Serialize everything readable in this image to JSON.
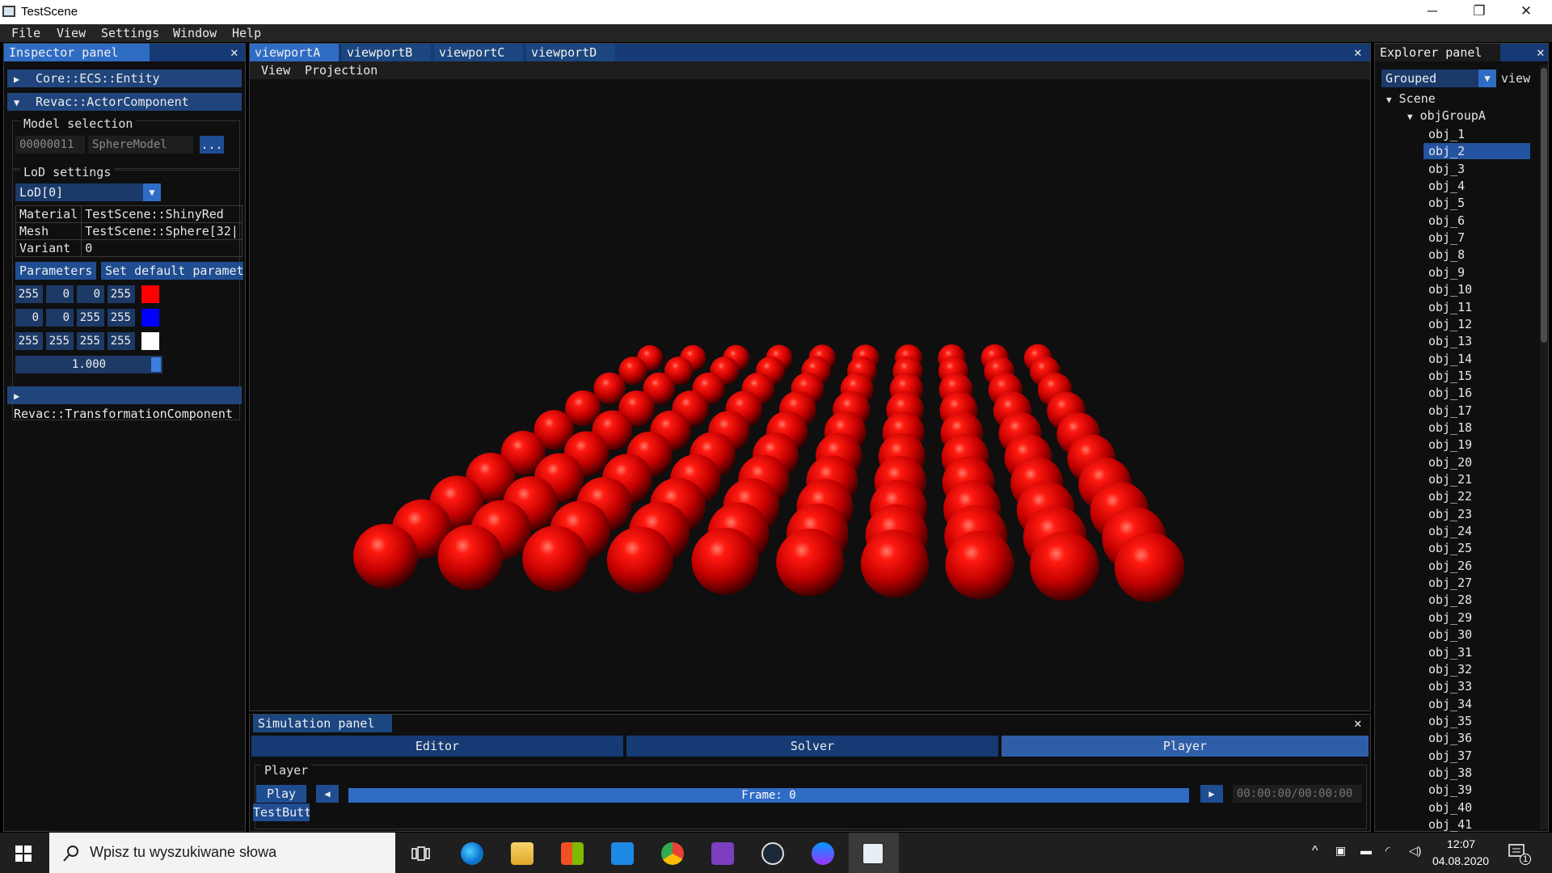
{
  "window": {
    "title": "TestScene",
    "minimize": "─",
    "restore": "❐",
    "close": "✕"
  },
  "menubar": [
    "File",
    "View",
    "Settings",
    "Window",
    "Help"
  ],
  "inspector": {
    "tab": "Inspector panel",
    "close": "✕",
    "entity_header": "Core::ECS::Entity",
    "actor_header": "Revac::ActorComponent",
    "model_selection_label": "Model selection",
    "model_id": "00000011",
    "model_name": "SphereModel",
    "browse_button": "...",
    "lod_settings_label": "LoD settings",
    "lod_selected": "LoD[0]",
    "props": [
      {
        "key": "Material",
        "value": "TestScene::ShinyRed"
      },
      {
        "key": "Mesh",
        "value": "TestScene::Sphere[32|"
      },
      {
        "key": "Variant",
        "value": "0"
      }
    ],
    "parameters_button": "Parameters",
    "set_default_button": "Set default paramete",
    "colors": [
      {
        "r": "255",
        "g": "0",
        "b": "0",
        "a": "255",
        "swatch": "#ff0000"
      },
      {
        "r": "0",
        "g": "0",
        "b": "255",
        "a": "255",
        "swatch": "#0000ff"
      },
      {
        "r": "255",
        "g": "255",
        "b": "255",
        "a": "255",
        "swatch": "#ffffff"
      }
    ],
    "slider_value": "1.000",
    "transform_header": "Revac::TransformationComponent",
    "arrow_collapsed": "▶",
    "arrow_expanded": "▼"
  },
  "viewport": {
    "tabs": [
      "viewportA",
      "viewportB",
      "viewportC",
      "viewportD"
    ],
    "active_tab": "viewportA",
    "close": "✕",
    "menu": [
      "View",
      "Projection"
    ],
    "sphere_color": "#e01010",
    "grid_rows": 10,
    "grid_cols": 10
  },
  "explorer": {
    "tab": "Explorer panel",
    "close": "✕",
    "mode": "Grouped",
    "view_label": "view",
    "root": "Scene",
    "group": "objGroupA",
    "selected": "obj_2",
    "items": [
      "obj_1",
      "obj_2",
      "obj_3",
      "obj_4",
      "obj_5",
      "obj_6",
      "obj_7",
      "obj_8",
      "obj_9",
      "obj_10",
      "obj_11",
      "obj_12",
      "obj_13",
      "obj_14",
      "obj_15",
      "obj_16",
      "obj_17",
      "obj_18",
      "obj_19",
      "obj_20",
      "obj_21",
      "obj_22",
      "obj_23",
      "obj_24",
      "obj_25",
      "obj_26",
      "obj_27",
      "obj_28",
      "obj_29",
      "obj_30",
      "obj_31",
      "obj_32",
      "obj_33",
      "obj_34",
      "obj_35",
      "obj_36",
      "obj_37",
      "obj_38",
      "obj_39",
      "obj_40",
      "obj_41"
    ]
  },
  "simulation": {
    "tab": "Simulation panel",
    "close": "✕",
    "tabs": [
      "Editor",
      "Solver",
      "Player"
    ],
    "active_tab": "Player",
    "player_label": "Player",
    "play_button": "Play",
    "test_button": "TestButt",
    "prev": "◀",
    "next": "▶",
    "progress": 0,
    "frame_text": "Frame: 0",
    "time": "00:00:00/00:00:00"
  },
  "taskbar": {
    "search_placeholder": "Wpisz tu wyszukiwane słowa",
    "time": "12:07",
    "date": "04.08.2020",
    "notifications": "1",
    "apps": [
      "task-view",
      "edge",
      "file-explorer",
      "store",
      "mail",
      "chrome",
      "visual-studio",
      "steam",
      "messenger",
      "testscene"
    ]
  },
  "colors": {
    "accent": "#2f6cc4",
    "header": "#20457c",
    "panel_bg": "#0f0f0f"
  }
}
